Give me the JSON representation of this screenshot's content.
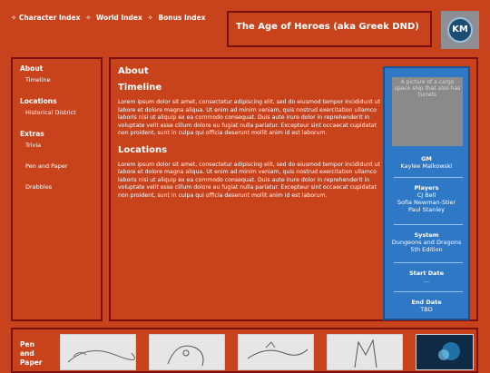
{
  "nav": {
    "star": "✧",
    "links": [
      "Character Index",
      "World Index",
      "Bonus Index"
    ]
  },
  "header": {
    "title": "The Age of Heroes (aka Greek DND)",
    "avatar_text": "KM"
  },
  "sidebar": {
    "sections": [
      {
        "heading": "About",
        "items": [
          "Timeline"
        ]
      },
      {
        "heading": "Locations",
        "items": [
          "Historical District"
        ]
      },
      {
        "heading": "Extras",
        "items": [
          "Trivia",
          "Pen and Paper",
          "Drabbles"
        ]
      }
    ]
  },
  "main": {
    "about_heading": "About",
    "timeline_heading": "Timeline",
    "timeline_text": "Lorem ipsum dolor sit amet, consectetur adipiscing elit, sed do eiusmod tempor incididunt ut labore et dolore magna aliqua. Ut enim ad minim veniam, quis nostrud exercitation ullamco laboris nisi ut aliquip ex ea commodo consequat. Duis aute irure dolor in reprehenderit in voluptate velit esse cillum dolore eu fugiat nulla pariatur. Excepteur sint occaecat cupidatat non proident, sunt in culpa qui officia deserunt mollit anim id est laborum.",
    "locations_heading": "Locations",
    "locations_text": "Lorem ipsum dolor sit amet, consectetur adipiscing elit, sed do eiusmod tempor incididunt ut labore et dolore magna aliqua. Ut enim ad minim veniam, quis nostrud exercitation ullamco laboris nisi ut aliquip ex ea commodo consequat. Duis aute irure dolor in reprehenderit in voluptate velit esse cillum dolore eu fugiat nulla pariatur. Excepteur sint occaecat cupidatat non proident, sunt in culpa qui officia deserunt mollit anim id est laborum."
  },
  "infobox": {
    "image_alt": "A picture of a cargo space ship that also has turrets",
    "gm_label": "GM",
    "gm_value": "Kaylee Malkowski",
    "players_label": "Players",
    "players": [
      "CJ Bell",
      "Sofia Newman-Stier",
      "Paul Stanley"
    ],
    "system_label": "System",
    "system_value": "Dungeons and Dragons 5th Edition",
    "start_label": "Start Date",
    "start_value": "...",
    "end_label": "End Date",
    "end_value": "TBD"
  },
  "gallery": {
    "label_line1": "Pen",
    "label_line2": "and",
    "label_line3": "Paper"
  }
}
